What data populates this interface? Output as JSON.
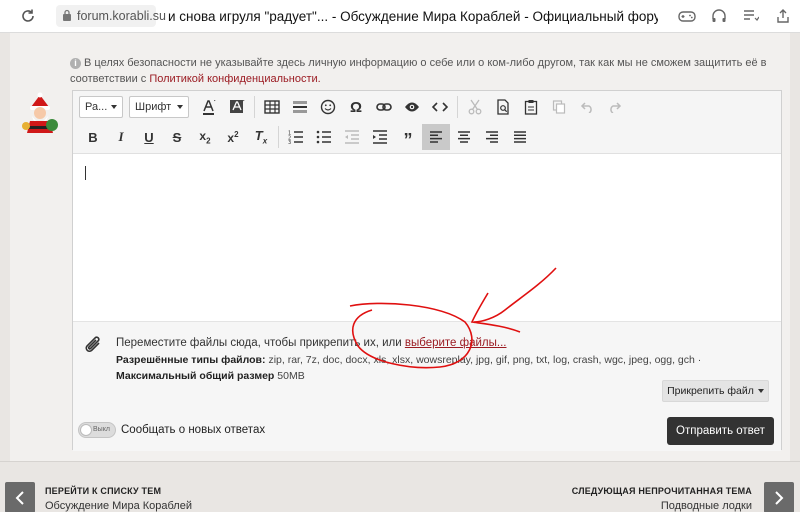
{
  "browser": {
    "url": "forum.korabli.su",
    "tab_title": "и снова игруля \"радует\"... - Обсуждение Мира Кораблей - Официальный форум игры..."
  },
  "notice": {
    "text": "В целях безопасности не указывайте здесь личную информацию о себе или о ком-либо другом, так как мы не сможем защитить её в соответствии с",
    "link": "Политикой конфиденциальности."
  },
  "toolbar": {
    "size_select": "Ра...",
    "font_select": "Шрифт"
  },
  "attach": {
    "drop_text": "Переместите файлы сюда, чтобы прикрепить их, или",
    "pick_link": "выберите файлы...",
    "allowed_label": "Разрешённые типы файлов:",
    "allowed_types": "zip, rar, 7z, doc, docx, xls, xlsx, wowsreplay, jpg, gif, png, txt, log, crash, wgc, jpeg, ogg, gch ·",
    "max_label": "Максимальный общий размер",
    "max_value": "50MB",
    "attach_button": "Прикрепить файл"
  },
  "notify": {
    "toggle_label": "Выкл",
    "label": "Сообщать о новых ответах"
  },
  "submit_label": "Отправить ответ",
  "nav": {
    "left_title": "ПЕРЕЙТИ К СПИСКУ ТЕМ",
    "left_sub": "Обсуждение Мира Кораблей",
    "right_title": "СЛЕДУЮЩАЯ НЕПРОЧИТАННАЯ ТЕМА",
    "right_sub": "Подводные лодки"
  },
  "colors": {
    "accent_red": "#9b1b22",
    "annotation_red": "#e01010",
    "submit_bg": "#333333"
  }
}
